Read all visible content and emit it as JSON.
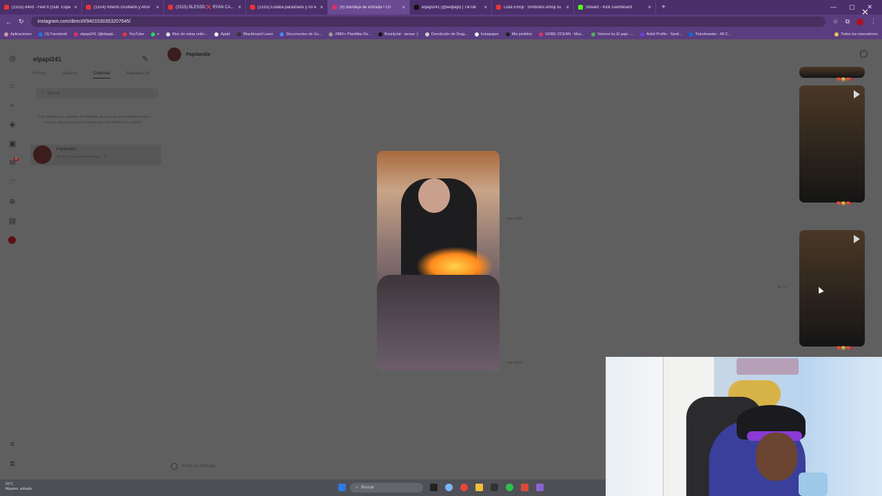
{
  "browser": {
    "tabs": [
      {
        "label": "(1515) d4vd - Feel It (Sub. Espa",
        "favicon_color": "#e53935"
      },
      {
        "label": "(1514) Intentó Ocultarlo y Ahor",
        "favicon_color": "#e53935"
      },
      {
        "label": "(1515) BLESSD ❌ RYAN CASTR",
        "favicon_color": "#e53935"
      },
      {
        "label": "(1515) Estaba paralizado y no e",
        "favicon_color": "#e53935"
      },
      {
        "label": "(9) Bandeja de entrada • Ch",
        "favicon_color": "#d6336c"
      },
      {
        "label": "elpapi241 (@eelpapi) | TikTok",
        "favicon_color": "#111111"
      },
      {
        "label": "Lista Emoji : Símbolos emoji su",
        "favicon_color": "#e53935"
      },
      {
        "label": "Stream - Kick Dashboard",
        "favicon_color": "#53fc18"
      }
    ],
    "url": "instagram.com/direct/t/9401530353207645/",
    "bookmarks": [
      "Aplicaciones",
      "(1) Facebook",
      "elpapi241 (@elpapi...",
      "YouTube",
      "e",
      "Bloc de notas onlin...",
      "Apple",
      "Blackboard Learn",
      "Documentos de Go...",
      "288K+ Plantillas De...",
      "Brainly.lat - tareas :)",
      "Devolución de Drag...",
      "Instapaper",
      "Mis pedidos",
      "GOBE OCEAN - Mus...",
      "Veneno by El papi -...",
      "Artist Profile - Spoti...",
      "Ticketmaster - Mi C...",
      "Todos los marcadores"
    ]
  },
  "instagram": {
    "username": "elpapi241",
    "tabs": [
      "Primary",
      "General",
      "Channels",
      "Requests (9)"
    ],
    "selected_tab": "Channels",
    "search_placeholder": "Buscar",
    "notice": "Solo puedes ver canales de difusión de los que eres administrador. Usa la aplicación para móviles para ver todos tus canales.",
    "notification_badge": "9",
    "thread": {
      "name": "Papilandia",
      "preview": "Ya no se les envía mensajes · 2h"
    },
    "chat_name": "Papilandia",
    "message_placeholder": "Envía un mensaje...",
    "timestamps": [
      "mié 15:55",
      "mié 15:52"
    ],
    "reel_reactions": [
      "❤️😂❤️ 47",
      "❤️😂❤️ 76",
      "❤️😂❤️ 52"
    ]
  },
  "taskbar": {
    "weather_temp": "20°C",
    "weather_desc": "Mayorm. soleado",
    "search_label": "Buscar"
  }
}
